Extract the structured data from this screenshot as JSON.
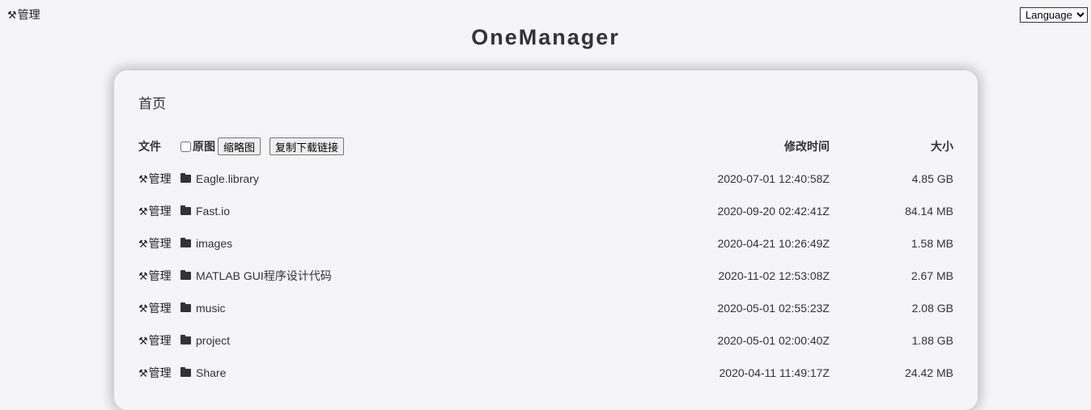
{
  "header": {
    "admin_label": "管理",
    "language_select": {
      "selected": "Language",
      "options": [
        "Language"
      ]
    },
    "site_title": "OneManager"
  },
  "breadcrumb": {
    "home": "首页"
  },
  "list_header": {
    "file_label": "文件",
    "original_checkbox_label": "原图",
    "thumbnail_button": "缩略图",
    "copy_links_button": "复制下载链接",
    "modified_label": "修改时间",
    "size_label": "大小"
  },
  "rows": [
    {
      "admin": "管理",
      "name": "Eagle.library",
      "modified": "2020-07-01 12:40:58Z",
      "size": "4.85 GB"
    },
    {
      "admin": "管理",
      "name": "Fast.io",
      "modified": "2020-09-20 02:42:41Z",
      "size": "84.14 MB"
    },
    {
      "admin": "管理",
      "name": "images",
      "modified": "2020-04-21 10:26:49Z",
      "size": "1.58 MB"
    },
    {
      "admin": "管理",
      "name": "MATLAB GUI程序设计代码",
      "modified": "2020-11-02 12:53:08Z",
      "size": "2.67 MB"
    },
    {
      "admin": "管理",
      "name": "music",
      "modified": "2020-05-01 02:55:23Z",
      "size": "2.08 GB"
    },
    {
      "admin": "管理",
      "name": "project",
      "modified": "2020-05-01 02:00:40Z",
      "size": "1.88 GB"
    },
    {
      "admin": "管理",
      "name": "Share",
      "modified": "2020-04-11 11:49:17Z",
      "size": "24.42 MB"
    }
  ]
}
